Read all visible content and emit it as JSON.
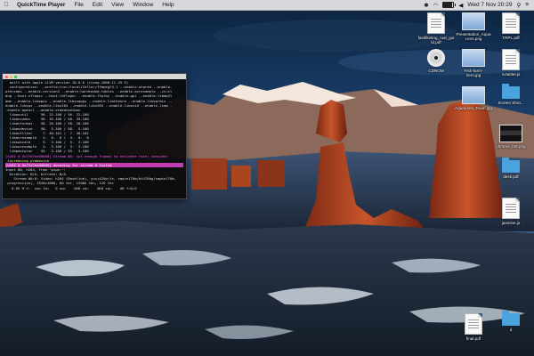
{
  "menubar": {
    "app_name": "QuickTime Player",
    "menus": [
      "File",
      "Edit",
      "View",
      "Window",
      "Help"
    ],
    "clock": "Wed 7 Nov 20:29",
    "battery_level": 0.85,
    "status_icons": [
      "bluetooth-icon",
      "wifi-icon",
      "battery-icon",
      "volume-icon",
      "search-icon",
      "notifications-icon"
    ]
  },
  "terminal": {
    "lines": [
      {
        "text": "  built with Apple LLVM version 10.0.0 (clang-1000.11.45.5)",
        "style": "normal"
      },
      {
        "text": "  configuration: --prefix=/usr/local/Cellar/ffmpeg/4.1 --enable-shared --enable-",
        "style": "normal"
      },
      {
        "text": "pthreads --enable-version3 --enable-hardcoded-tables --enable-avresample --cc=cl",
        "style": "normal"
      },
      {
        "text": "ang --host-cflags= --host-ldflags= --enable-ffplay --enable-gpl --enable-libmp3l",
        "style": "normal"
      },
      {
        "text": "ame --enable-libopus --enable-libsnappy --enable-libtheora --enable-libvorbis --",
        "style": "normal"
      },
      {
        "text": "enable-libvpx --enable-libx264 --enable-libx265 --enable-libxvid --enable-lzma -",
        "style": "normal"
      },
      {
        "text": "-enable-opencl --enable-videotoolbox",
        "style": "normal"
      },
      {
        "text": "  libavutil      56. 22.100 / 56. 22.100",
        "style": "normal"
      },
      {
        "text": "  libavcodec     58. 35.100 / 58. 35.100",
        "style": "normal"
      },
      {
        "text": "  libavformat    58. 20.100 / 58. 20.100",
        "style": "normal"
      },
      {
        "text": "  libavdevice    58.  5.100 / 58.  5.100",
        "style": "normal"
      },
      {
        "text": "  libavfilter     7. 40.101 /  7. 40.101",
        "style": "normal"
      },
      {
        "text": "  libavresample   4.  0.  0 /  4.  0.  0",
        "style": "normal"
      },
      {
        "text": "  libswscale      5.  3.100 /  5.  3.100",
        "style": "normal"
      },
      {
        "text": "  libswresample   3.  3.100 /  3.  3.100",
        "style": "normal"
      },
      {
        "text": "  libpostproc    55.  3.100 / 55.  3.100",
        "style": "normal"
      },
      {
        "text": "[h264 @ 0x7fd7ee00000] Stream #0: not enough frames to estimate rate; consider",
        "style": "purple"
      },
      {
        "text": " increasing probesize",
        "style": "yellow"
      },
      {
        "text": "[h264 @ 0x7fd7ee00000] decoding for stream 0 failed",
        "style": "highlight"
      },
      {
        "text": "Input #0, h264, from 'pipe:':",
        "style": "normal"
      },
      {
        "text": "  Duration: N/A, bitrate: N/A",
        "style": "normal"
      },
      {
        "text": "    Stream #0:0: Video: h264 (Baseline), yuvj420p(tv, smpte170m/bt470bg/smpte170m,",
        "style": "normal"
      },
      {
        "text": " progressive), 1920x1080, 60 tbr, 1200k tbn, 120 tbc",
        "style": "normal"
      },
      {
        "text": "   0.89 M-V:  nan fd=   0 aq=    0KB vq=    0KB sq=    0B f=0/0",
        "style": "status"
      }
    ]
  },
  "desktop_icons": [
    {
      "name": "desktop-file-ttf",
      "label": "lecture_Rakesh_rott...",
      "line2": "",
      "kind": "blank"
    },
    {
      "name": "desktop-file-fastfilteting",
      "label": "fastfilteting_rust_gui",
      "line2": "ld.pdf",
      "kind": "doc"
    },
    {
      "name": "desktop-file-presentation",
      "label": "Presentation_Aqua",
      "line2": "Lens.png",
      "kind": "image"
    },
    {
      "name": "desktop-file-trpl",
      "label": "TRPL.pdf",
      "line2": "",
      "kind": "doc"
    },
    {
      "name": "desktop-cdrom",
      "label": "CDROM",
      "line2": "",
      "kind": "cd"
    },
    {
      "name": "desktop-file-fish",
      "label": "Fish-farm-",
      "line2": "hero.jpg",
      "kind": "image"
    },
    {
      "name": "desktop-file-nvtabler",
      "label": "nvtabler.js",
      "line2": "",
      "kind": "doc"
    },
    {
      "name": "desktop-file-aqualens",
      "label": "AquaLens_Team.jpg",
      "line2": "",
      "kind": "image"
    },
    {
      "name": "desktop-file-screenshot",
      "label": "Screen Shot...",
      "line2": "",
      "kind": "folder"
    },
    {
      "name": "desktop-file-chrome",
      "label": "chrome_bot.png",
      "line2": "",
      "kind": "imagedark"
    },
    {
      "name": "desktop-file-deskpdf",
      "label": "desk.pdf",
      "line2": "",
      "kind": "folder"
    },
    {
      "name": "desktop-file-jasmine",
      "label": "jasmine.js",
      "line2": "",
      "kind": "doc"
    },
    {
      "name": "desktop-file-final",
      "label": "final.pdf",
      "line2": "",
      "kind": "doc"
    },
    {
      "name": "desktop-folder-d",
      "label": "d",
      "line2": "",
      "kind": "folder"
    }
  ]
}
